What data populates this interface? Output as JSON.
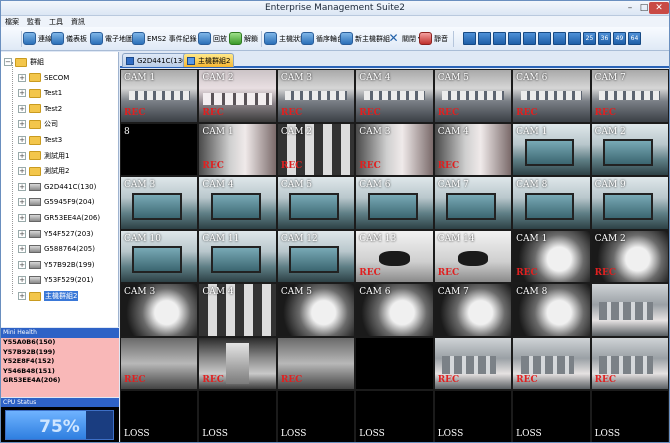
{
  "window": {
    "title": "Enterprise Management Suite2",
    "controls": [
      "–",
      "□",
      "✕"
    ]
  },
  "menu": [
    "檔案",
    "監看",
    "工具",
    "資訊"
  ],
  "toolbar": {
    "buttons": [
      {
        "label": "連線",
        "icon": "connect-icon"
      },
      {
        "label": "儀表板",
        "icon": "dashboard-icon"
      },
      {
        "label": "電子地圖",
        "icon": "emap-icon"
      },
      {
        "label": "EMS2 事件紀錄",
        "icon": "event-log-icon"
      },
      {
        "label": "回放",
        "icon": "playback-icon"
      },
      {
        "label": "解鎖",
        "icon": "unlock-icon"
      },
      {
        "label": "主機狀態",
        "icon": "host-status-icon"
      },
      {
        "label": "循序輪台",
        "icon": "sequence-icon"
      },
      {
        "label": "新主機群組",
        "icon": "new-group-icon"
      },
      {
        "label": "關閉",
        "icon": "close-icon"
      },
      {
        "label": "靜音",
        "icon": "mute-icon"
      }
    ],
    "layouts": [
      "1",
      "4",
      "6",
      "8",
      "9",
      "10",
      "13",
      "16",
      "25",
      "36",
      "49",
      "64"
    ]
  },
  "tree": {
    "root": "群組",
    "items": [
      {
        "label": "SECOM",
        "type": "folder"
      },
      {
        "label": "Test1",
        "type": "folder"
      },
      {
        "label": "Test2",
        "type": "folder"
      },
      {
        "label": "公司",
        "type": "folder"
      },
      {
        "label": "Test3",
        "type": "folder"
      },
      {
        "label": "測試用1",
        "type": "folder"
      },
      {
        "label": "測試用2",
        "type": "folder"
      },
      {
        "label": "G2D441C(130)",
        "type": "device"
      },
      {
        "label": "G5945F9(204)",
        "type": "device"
      },
      {
        "label": "GR53EE4A(206)",
        "type": "device"
      },
      {
        "label": "Y54F527(203)",
        "type": "device"
      },
      {
        "label": "G588764(205)",
        "type": "device"
      },
      {
        "label": "Y57B92B(199)",
        "type": "device"
      },
      {
        "label": "Y53F529(201)",
        "type": "device"
      },
      {
        "label": "主機群組2",
        "type": "folder",
        "selected": true
      }
    ]
  },
  "mini_health": {
    "title": "Mini Health",
    "items": [
      "Y55A0B6(150)",
      "Y57B92B(199)",
      "Y52E8F4(152)",
      "Y546B48(151)",
      "GR53EE4A(206)"
    ]
  },
  "cpu": {
    "title": "CPU Status",
    "value": "75%",
    "level": 0.75
  },
  "tabs": [
    {
      "label": "G2D441C(130)",
      "active": false
    },
    {
      "label": "主機群組2",
      "active": true
    }
  ],
  "cells": [
    {
      "cam": "CAM 1",
      "rec": "REC",
      "theme": "office"
    },
    {
      "cam": "CAM 2",
      "rec": "REC",
      "theme": "pinkoffice"
    },
    {
      "cam": "CAM 3",
      "rec": "REC",
      "theme": "office"
    },
    {
      "cam": "CAM 4",
      "rec": "REC",
      "theme": "office"
    },
    {
      "cam": "CAM 5",
      "rec": "REC",
      "theme": "office"
    },
    {
      "cam": "CAM 6",
      "rec": "REC",
      "theme": "office"
    },
    {
      "cam": "CAM 7",
      "rec": "REC",
      "theme": "office"
    },
    {
      "cam": "8",
      "rec": "",
      "theme": "dark"
    },
    {
      "cam": "CAM 1",
      "rec": "REC",
      "theme": "door"
    },
    {
      "cam": "CAM 2",
      "rec": "REC",
      "theme": "mosaic"
    },
    {
      "cam": "CAM 3",
      "rec": "REC",
      "theme": "door"
    },
    {
      "cam": "CAM 4",
      "rec": "REC",
      "theme": "door"
    },
    {
      "cam": "CAM 1",
      "rec": "",
      "theme": "blue"
    },
    {
      "cam": "CAM 2",
      "rec": "",
      "theme": "blue"
    },
    {
      "cam": "CAM 3",
      "rec": "",
      "theme": "blue"
    },
    {
      "cam": "CAM 4",
      "rec": "",
      "theme": "blue"
    },
    {
      "cam": "CAM 5",
      "rec": "",
      "theme": "blue"
    },
    {
      "cam": "CAM 6",
      "rec": "",
      "theme": "blue"
    },
    {
      "cam": "CAM 7",
      "rec": "",
      "theme": "blue"
    },
    {
      "cam": "CAM 8",
      "rec": "",
      "theme": "blue"
    },
    {
      "cam": "CAM 9",
      "rec": "",
      "theme": "blue"
    },
    {
      "cam": "CAM 10",
      "rec": "",
      "theme": "blue"
    },
    {
      "cam": "CAM 11",
      "rec": "",
      "theme": "blue"
    },
    {
      "cam": "CAM 12",
      "rec": "",
      "theme": "blue"
    },
    {
      "cam": "CAM 13",
      "rec": "REC",
      "theme": "phone"
    },
    {
      "cam": "CAM 14",
      "rec": "REC",
      "theme": "phone"
    },
    {
      "cam": "CAM 1",
      "rec": "REC",
      "theme": "bw"
    },
    {
      "cam": "CAM 2",
      "rec": "REC",
      "theme": "bw"
    },
    {
      "cam": "CAM 3",
      "rec": "",
      "theme": "bw"
    },
    {
      "cam": "CAM 4",
      "rec": "",
      "theme": "mosaic"
    },
    {
      "cam": "CAM 5",
      "rec": "",
      "theme": "bw"
    },
    {
      "cam": "CAM 6",
      "rec": "",
      "theme": "bw"
    },
    {
      "cam": "CAM 7",
      "rec": "",
      "theme": "bw"
    },
    {
      "cam": "CAM 8",
      "rec": "",
      "theme": "bw"
    },
    {
      "cam": "",
      "rec": "",
      "theme": "machine"
    },
    {
      "cam": "",
      "rec": "REC",
      "theme": "grayroom"
    },
    {
      "cam": "",
      "rec": "REC",
      "theme": "hall"
    },
    {
      "cam": "",
      "rec": "REC",
      "theme": "grayroom"
    },
    {
      "cam": "",
      "rec": "",
      "theme": "dark"
    },
    {
      "cam": "",
      "rec": "REC",
      "theme": "machine"
    },
    {
      "cam": "",
      "rec": "REC",
      "theme": "machine"
    },
    {
      "cam": "",
      "rec": "REC",
      "theme": "machine"
    },
    {
      "cam": "",
      "rec": "LOSS",
      "theme": "dark"
    },
    {
      "cam": "",
      "rec": "LOSS",
      "theme": "dark"
    },
    {
      "cam": "",
      "rec": "LOSS",
      "theme": "dark"
    },
    {
      "cam": "",
      "rec": "LOSS",
      "theme": "dark"
    },
    {
      "cam": "",
      "rec": "LOSS",
      "theme": "dark"
    },
    {
      "cam": "",
      "rec": "LOSS",
      "theme": "dark"
    },
    {
      "cam": "",
      "rec": "LOSS",
      "theme": "dark"
    }
  ]
}
